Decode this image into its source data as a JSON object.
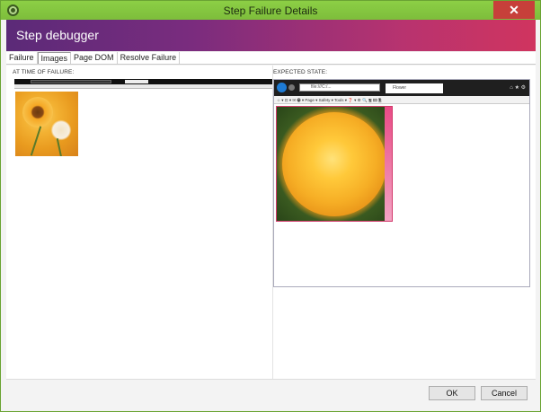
{
  "window": {
    "title": "Step Failure Details",
    "close_glyph": "✕"
  },
  "header": {
    "title": "Step debugger"
  },
  "tabs": [
    {
      "label": "Failure"
    },
    {
      "label": "Images"
    },
    {
      "label": "Page DOM"
    },
    {
      "label": "Resolve Failure"
    }
  ],
  "active_tab": "Images",
  "panes": {
    "failure_label": "AT TIME OF FAILURE:",
    "expected_label": "EXPECTED STATE:"
  },
  "expected_browser": {
    "url_text": "file:///C:/...",
    "tab_text": "Flower",
    "menu_text": "☆ ▾  ⊡ ▾  ✉  🖶 ▾  Page ▾  Safety ▾  Tools ▾  ❓ ▾  ⚙ 🔍 🖫 🖾 🖹",
    "sys_icons": "⌂ ★ ⚙"
  },
  "footer": {
    "ok_label": "OK",
    "cancel_label": "Cancel"
  },
  "icons": {
    "app": "app-gear-icon",
    "close": "close-icon",
    "back": "back-arrow-icon",
    "forward": "forward-arrow-icon"
  },
  "colors": {
    "titlebar": "#8bc34a",
    "header_start": "#5b2a78",
    "header_end": "#d0345f",
    "close": "#c7403a"
  }
}
